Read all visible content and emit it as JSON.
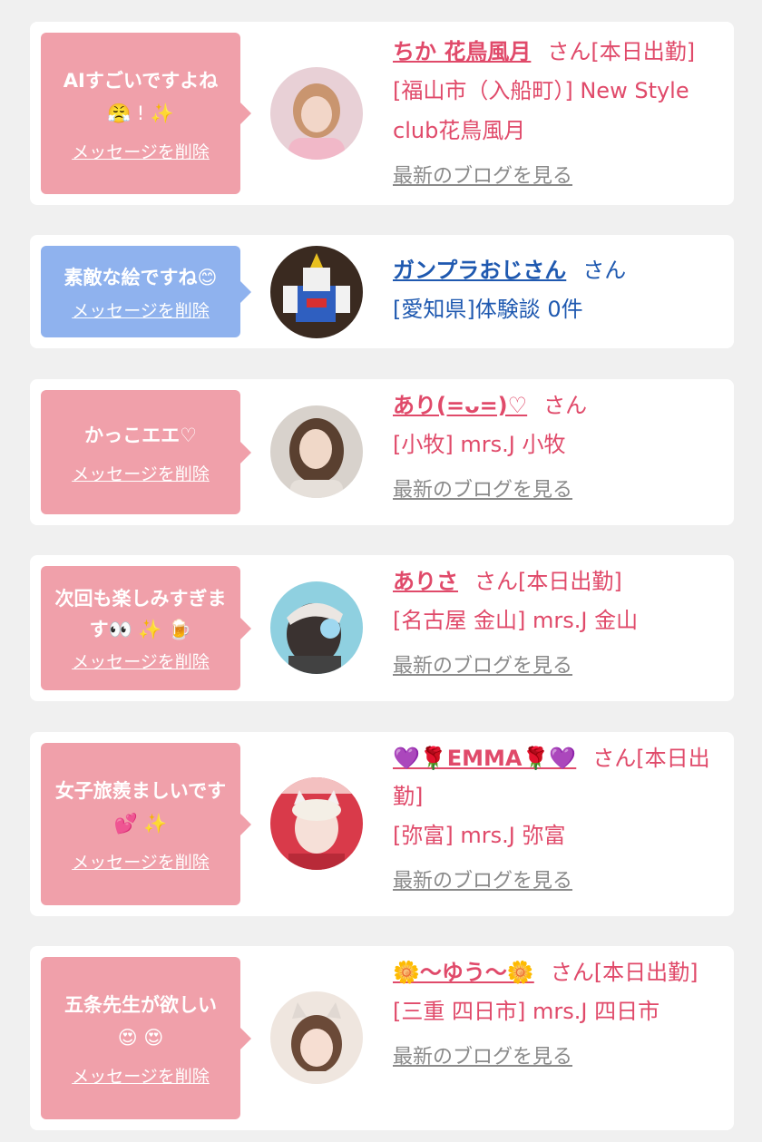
{
  "cards": [
    {
      "message": "AIすごいですよね",
      "message_emoji": "😤 ! ✨",
      "delete_label": "メッセージを削除",
      "name": "ちか 花鳥風月",
      "san": "さん[本日出勤]",
      "shop": "[福山市（入船町）] New Style club花鳥風月",
      "blog_label": "最新のブログを見る",
      "bubble_color": "#f0a0aa",
      "avatar_icon": "woman-portrait"
    },
    {
      "message": "素敵な絵ですね",
      "message_emoji": "😊",
      "delete_label": "メッセージを削除",
      "name": "ガンプラおじさん",
      "san": "さん",
      "shop": "[愛知県]体験談 0件",
      "bubble_color": "#8fb2ee",
      "avatar_icon": "gundam-model"
    },
    {
      "message": "かっこエエ♡",
      "delete_label": "メッセージを削除",
      "name": "あり(=ᴗ=)♡",
      "san": "さん",
      "shop": "[小牧] mrs.J 小牧",
      "blog_label": "最新のブログを見る",
      "bubble_color": "#f0a0aa",
      "avatar_icon": "woman-portrait"
    },
    {
      "message": "次回も楽しみすぎます",
      "message_emoji": "👀 ✨ 🍺",
      "delete_label": "メッセージを削除",
      "name": "ありさ",
      "san": "さん[本日出勤]",
      "shop": "[名古屋 金山] mrs.J 金山",
      "blog_label": "最新のブログを見る",
      "bubble_color": "#f0a0aa",
      "avatar_icon": "woman-with-cap"
    },
    {
      "message": "女子旅羨ましいです",
      "message_emoji": "💕 ✨",
      "delete_label": "メッセージを削除",
      "name": "💜🌹EMMA🌹💜",
      "san": "さん[本日出勤]",
      "shop": "[弥富] mrs.J 弥富",
      "blog_label": "最新のブログを見る",
      "bubble_color": "#f0a0aa",
      "avatar_icon": "woman-cat-ears"
    },
    {
      "message": "五条先生が欲しい",
      "message_emoji": "😍 😍",
      "delete_label": "メッセージを削除",
      "name": "🌼〜ゆう〜🌼",
      "san": "さん[本日出勤]",
      "shop": "[三重 四日市] mrs.J 四日市",
      "blog_label": "最新のブログを見る",
      "bubble_color": "#f0a0aa",
      "avatar_icon": "woman-cat-ears"
    }
  ]
}
